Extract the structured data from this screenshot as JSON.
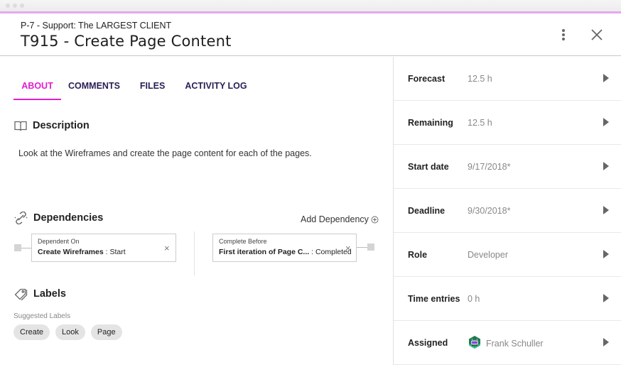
{
  "window": {
    "title_dots": 3,
    "accent_color": "#e6a8ee"
  },
  "header": {
    "project": "P-7 - Support: The LARGEST CLIENT",
    "task_title": "T915 -  Create Page Content",
    "menu_icon": "more-vert-icon",
    "close_icon": "close-icon"
  },
  "tabs": [
    {
      "label": "ABOUT",
      "active": true
    },
    {
      "label": "COMMENTS",
      "active": false
    },
    {
      "label": "FILES",
      "active": false
    },
    {
      "label": "ACTIVITY LOG",
      "active": false
    }
  ],
  "description": {
    "heading": "Description",
    "icon": "book-icon",
    "text": "Look at the Wireframes and create the page content for each of the pages."
  },
  "dependencies": {
    "heading": "Dependencies",
    "icon": "link-icon",
    "add_label": "Add Dependency",
    "items": [
      {
        "type": "Dependent On",
        "task": "Create Wireframes",
        "status": ": Start"
      },
      {
        "type": "Complete Before",
        "task": "First iteration of Page C...",
        "status": ": Completed"
      }
    ]
  },
  "labels": {
    "heading": "Labels",
    "icon": "tag-icon",
    "suggested_label": "Suggested Labels",
    "suggested": [
      "Create",
      "Look",
      "Page"
    ]
  },
  "details": [
    {
      "label": "Forecast",
      "value": "12.5 h"
    },
    {
      "label": "Remaining",
      "value": "12.5 h"
    },
    {
      "label": "Start date",
      "value": "9/17/2018*"
    },
    {
      "label": "Deadline",
      "value": "9/30/2018*"
    },
    {
      "label": "Role",
      "value": "Developer"
    },
    {
      "label": "Time entries",
      "value": "0 h"
    },
    {
      "label": "Assigned",
      "value": "Frank Schuller",
      "avatar": "robot-avatar"
    }
  ],
  "colors": {
    "tab_active": "#e01fcd",
    "tab_inactive": "#2a1e55"
  }
}
